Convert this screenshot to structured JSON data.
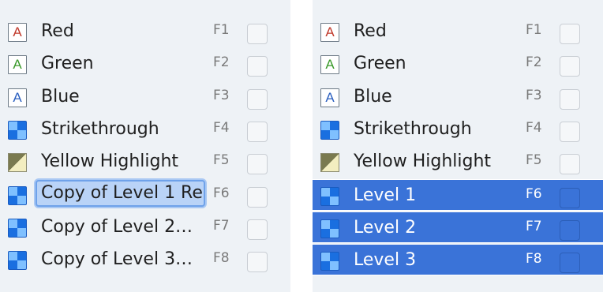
{
  "left_panel": {
    "rows": [
      {
        "icon": "letter-a-red-icon",
        "icon_text": "A",
        "icon_color": "#c0392b",
        "label": "Red",
        "key": "F1"
      },
      {
        "icon": "letter-a-green-icon",
        "icon_text": "A",
        "icon_color": "#3a9a2a",
        "label": "Green",
        "key": "F2"
      },
      {
        "icon": "letter-a-blue-icon",
        "icon_text": "A",
        "icon_color": "#2a5fbf",
        "label": "Blue",
        "key": "F3"
      },
      {
        "icon": "style-swatch-icon",
        "label": "Strikethrough",
        "key": "F4"
      },
      {
        "icon": "highlight-swatch-icon",
        "label": "Yellow Highlight",
        "key": "F5"
      },
      {
        "icon": "style-swatch-icon",
        "label": "Copy of Level 1 Re",
        "key": "F6",
        "editing": true
      },
      {
        "icon": "style-swatch-icon",
        "label": "Copy of Level 2…",
        "key": "F7"
      },
      {
        "icon": "style-swatch-icon",
        "label": "Copy of Level 3…",
        "key": "F8"
      }
    ]
  },
  "right_panel": {
    "rows": [
      {
        "icon": "letter-a-red-icon",
        "icon_text": "A",
        "icon_color": "#c0392b",
        "label": "Red",
        "key": "F1"
      },
      {
        "icon": "letter-a-green-icon",
        "icon_text": "A",
        "icon_color": "#3a9a2a",
        "label": "Green",
        "key": "F2"
      },
      {
        "icon": "letter-a-blue-icon",
        "icon_text": "A",
        "icon_color": "#2a5fbf",
        "label": "Blue",
        "key": "F3"
      },
      {
        "icon": "style-swatch-icon",
        "label": "Strikethrough",
        "key": "F4"
      },
      {
        "icon": "highlight-swatch-icon",
        "label": "Yellow Highlight",
        "key": "F5"
      },
      {
        "icon": "style-swatch-icon",
        "label": "Level 1",
        "key": "F6",
        "selected": true
      },
      {
        "icon": "style-swatch-icon",
        "label": "Level 2",
        "key": "F7",
        "selected": true
      },
      {
        "icon": "style-swatch-icon",
        "label": "Level 3",
        "key": "F8",
        "selected": true
      }
    ]
  },
  "colors": {
    "panel_background": "#eef2f6",
    "selection": "#3a73d8",
    "edit_field": "#b9d3f7"
  }
}
